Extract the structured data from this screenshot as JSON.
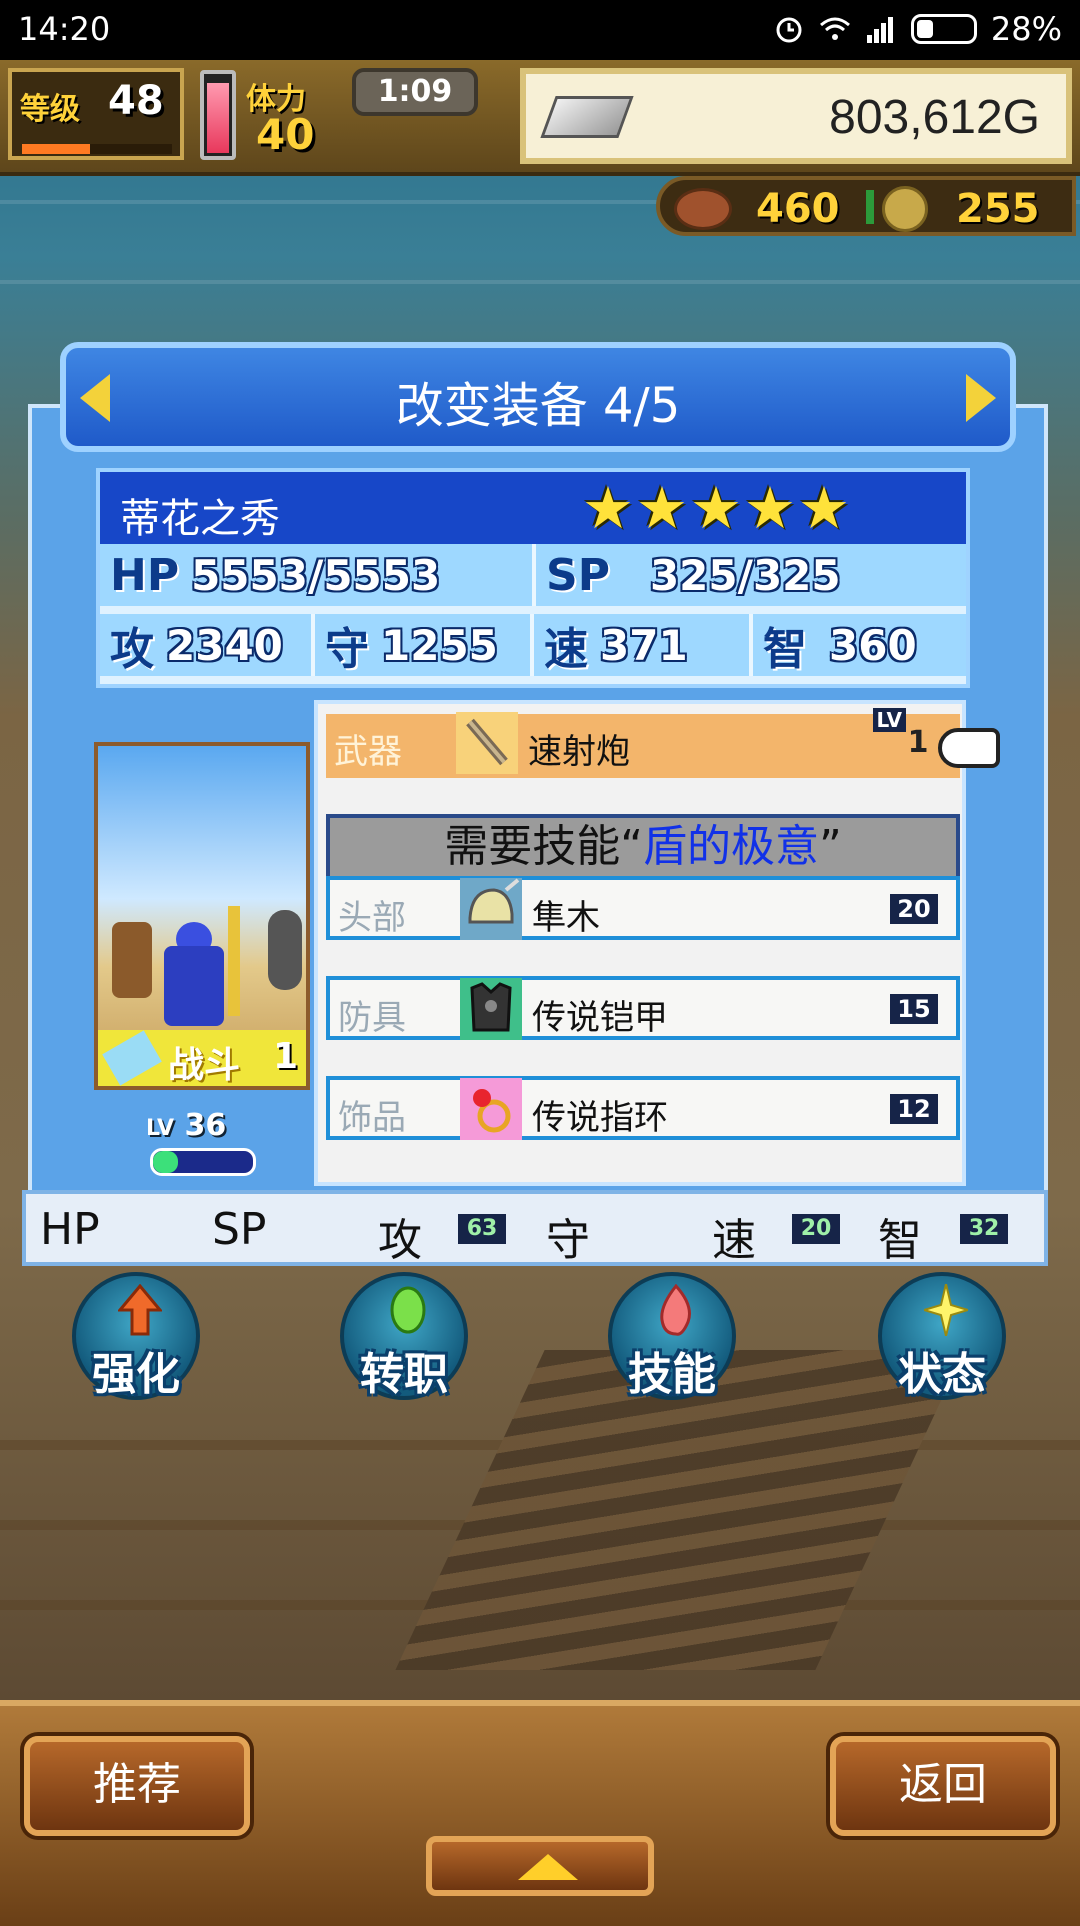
{
  "status_bar": {
    "time": "14:20",
    "battery": "28%"
  },
  "hud": {
    "level_label": "等级",
    "level": "48",
    "stamina_label": "体力",
    "stamina": "40",
    "timer": "1:09",
    "gold": "803,612G",
    "meat": "460",
    "medals": "255"
  },
  "panel": {
    "title": "改变装备 4/5",
    "character": {
      "name": "蒂花之秀",
      "stars": 5,
      "hp_label": "HP",
      "hp": "5553/5553",
      "sp_label": "SP",
      "sp": "325/325",
      "atk_label": "攻",
      "atk": "2340",
      "def_label": "守",
      "def": "1255",
      "spd_label": "速",
      "spd": "371",
      "int_label": "智",
      "int": "360",
      "job": "战斗",
      "job_level": "1",
      "level_label": "LV",
      "level": "36"
    },
    "equipment": {
      "lv_tag": "LV",
      "weapon": {
        "slot": "武器",
        "name": "速射炮",
        "level": "1"
      },
      "skill_req_prefix": "需要技能“",
      "skill_req_name": "盾的极意",
      "skill_req_suffix": "”",
      "head": {
        "slot": "头部",
        "name": "隼木",
        "level": "20"
      },
      "armor": {
        "slot": "防具",
        "name": "传说铠甲",
        "level": "15"
      },
      "accessory": {
        "slot": "饰品",
        "name": "传说指环",
        "level": "12"
      }
    },
    "bonus": {
      "hp_label": "HP",
      "sp_label": "SP",
      "atk_label": "攻",
      "atk": "63",
      "def_label": "守",
      "spd_label": "速",
      "spd": "20",
      "int_label": "智",
      "int": "32"
    }
  },
  "actions": {
    "enhance": "强化",
    "change_job": "转职",
    "skill": "技能",
    "status": "状态"
  },
  "bottom": {
    "recommend": "推荐",
    "back": "返回"
  },
  "colors": {
    "panel": "#5ba3e8",
    "title_banner": "#1f5ac9",
    "selected_row": "#f3b56b",
    "skill_highlight": "#1131e8"
  }
}
